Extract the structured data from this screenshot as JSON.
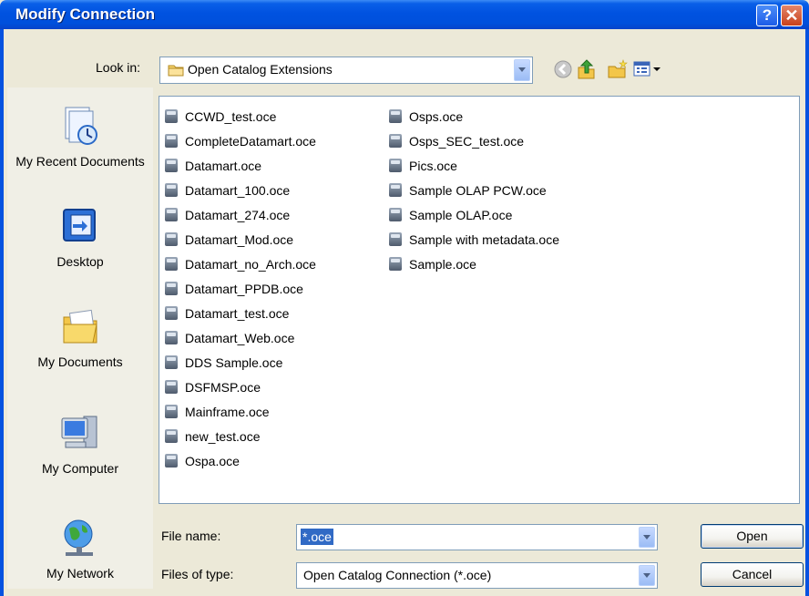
{
  "window": {
    "title": "Modify Connection",
    "help_icon": "?",
    "close_icon": "✕"
  },
  "look_in": {
    "label": "Look in:",
    "value": "Open Catalog Extensions"
  },
  "toolbar_icons": [
    "back-icon",
    "up-folder-icon",
    "new-folder-icon",
    "views-menu-icon"
  ],
  "places": [
    {
      "label": "My Recent Documents",
      "icon": "recent-documents-icon"
    },
    {
      "label": "Desktop",
      "icon": "desktop-icon"
    },
    {
      "label": "My Documents",
      "icon": "my-documents-icon"
    },
    {
      "label": "My Computer",
      "icon": "my-computer-icon"
    },
    {
      "label": "My Network",
      "icon": "network-icon"
    }
  ],
  "files": {
    "column1": [
      "CCWD_test.oce",
      "CompleteDatamart.oce",
      "Datamart.oce",
      "Datamart_100.oce",
      "Datamart_274.oce",
      "Datamart_Mod.oce",
      "Datamart_no_Arch.oce",
      "Datamart_PPDB.oce",
      "Datamart_test.oce",
      "Datamart_Web.oce",
      "DDS Sample.oce",
      "DSFMSP.oce",
      "Mainframe.oce",
      "new_test.oce",
      "Ospa.oce"
    ],
    "column2": [
      "Osps.oce",
      "Osps_SEC_test.oce",
      "Pics.oce",
      "Sample OLAP PCW.oce",
      "Sample OLAP.oce",
      "Sample with metadata.oce",
      "Sample.oce"
    ]
  },
  "file_name": {
    "label": "File name:",
    "value": "*.oce"
  },
  "files_of_type": {
    "label": "Files of type:",
    "value": "Open Catalog Connection (*.oce)"
  },
  "buttons": {
    "open": "Open",
    "cancel": "Cancel"
  },
  "colors": {
    "titlebar": "#0052e0",
    "selection": "#316ac5",
    "dialog_bg": "#ece9d8"
  }
}
